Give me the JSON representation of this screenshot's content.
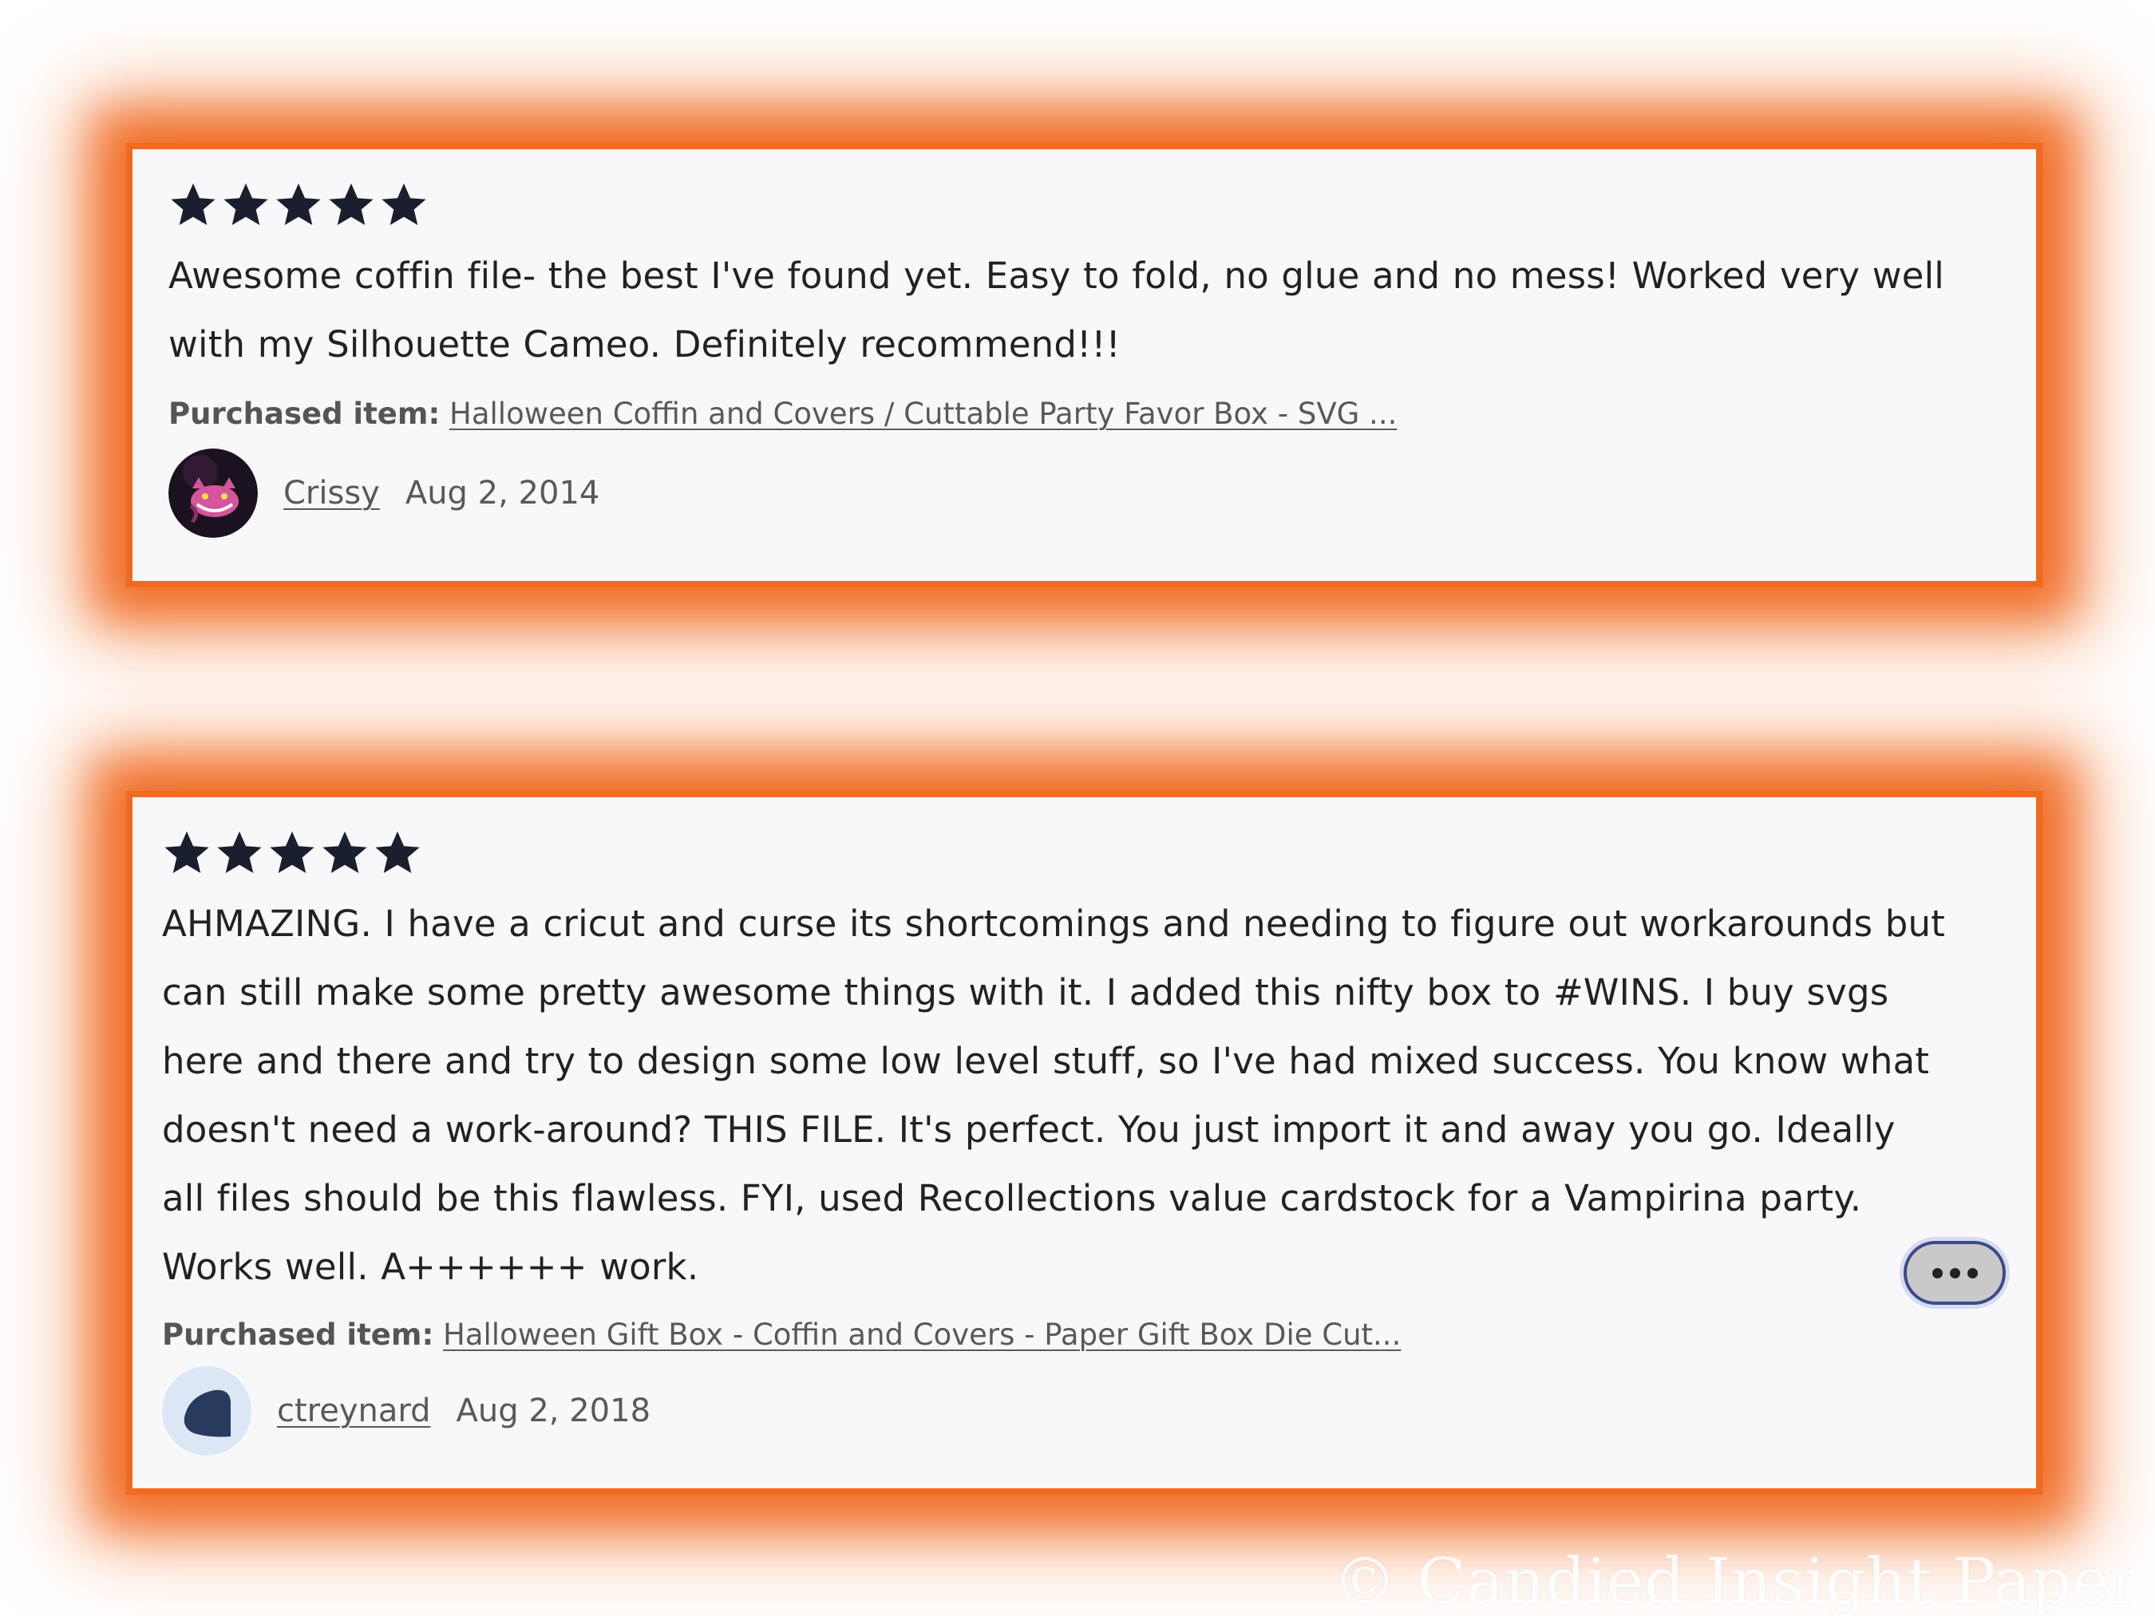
{
  "reviews": [
    {
      "rating": 5,
      "text": "Awesome coffin file- the best I've found yet. Easy to fold, no glue and no mess! Worked very well with my Silhouette Cameo. Definitely recommend!!!",
      "purchased_label": "Purchased item:",
      "purchased_item": "Halloween Coffin and Covers / Cuttable Party Favor Box - SVG ...",
      "author": "Crissy",
      "date": "Aug 2, 2014",
      "avatar_icon": "cheshire-cat-avatar-icon"
    },
    {
      "rating": 5,
      "text": "AHMAZING. I have a cricut and curse its shortcomings and needing to figure out workarounds but can still make some pretty awesome things with it. I added this nifty box to #WINS. I buy svgs here and there and try to design some low level stuff, so I've had mixed success. You know what doesn't need a work-around? THIS FILE. It's perfect. You just import it and away you go. Ideally all files should be this flawless. FYI, used Recollections value cardstock for a Vampirina party. Works well. A++++++ work.",
      "purchased_label": "Purchased item:",
      "purchased_item": "Halloween Gift Box - Coffin and Covers - Paper Gift Box Die Cut...",
      "author": "ctreynard",
      "date": "Aug 2, 2018",
      "avatar_icon": "default-user-avatar-icon",
      "more_button_icon": "ellipsis-icon"
    }
  ],
  "watermark": "© Candied Insight Paper Z",
  "colors": {
    "highlight": "#f06a1f",
    "card_background": "#f8f8fa",
    "star": "#1a1f2e",
    "more_button_ring": "#3c4a8a"
  }
}
